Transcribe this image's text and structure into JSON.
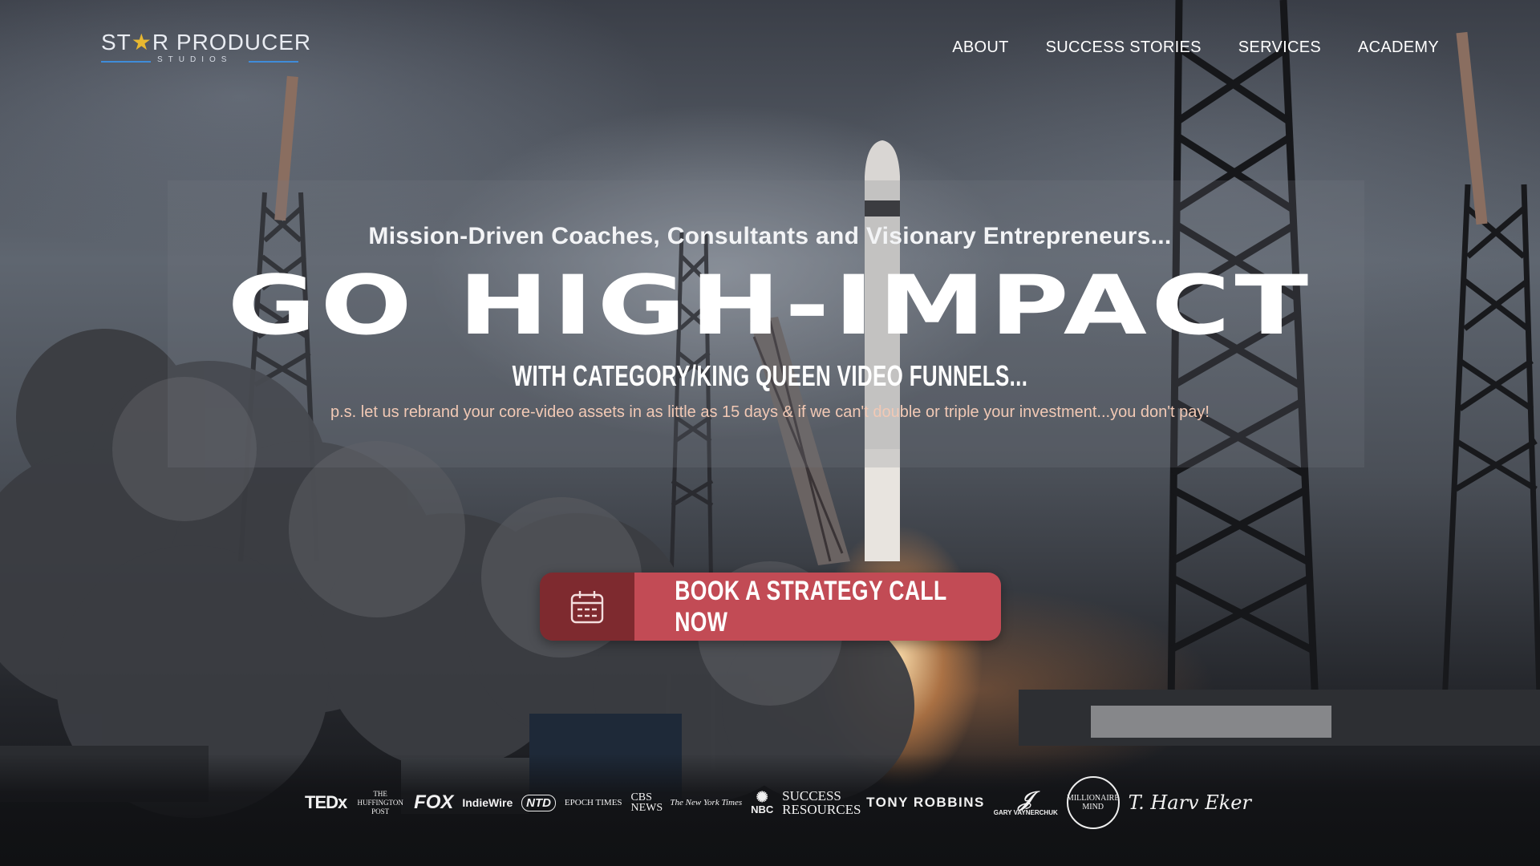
{
  "header": {
    "logo": {
      "text_before_star": "ST",
      "star_glyph": "★",
      "text_after_star": "R PRODUCER",
      "subtext": "STUDIOS"
    },
    "nav": [
      {
        "label": "ABOUT"
      },
      {
        "label": "SUCCESS STORIES"
      },
      {
        "label": "SERVICES"
      },
      {
        "label": "ACADEMY"
      }
    ]
  },
  "hero": {
    "eyebrow": "Mission-Driven Coaches, Consultants and Visionary Entrepreneurs...",
    "title": "GO HIGH-IMPACT",
    "subtitle": "WITH CATEGORY/KING QUEEN VIDEO FUNNELS...",
    "ps": "p.s. let us rebrand your core-video assets in as little as 15 days & if we can't double or triple your investment...you don't pay!",
    "cta": {
      "label": "BOOK A STRATEGY CALL NOW",
      "icon": "calendar-icon"
    }
  },
  "press_logos": [
    {
      "text": "TEDx"
    },
    {
      "text": "THE HUFFINGTON POST"
    },
    {
      "text": "FOX"
    },
    {
      "text": "IndieWire"
    },
    {
      "text": "NTD"
    },
    {
      "text": "EPOCH TIMES"
    },
    {
      "text": "CBS NEWS"
    },
    {
      "text": "The New York Times"
    },
    {
      "text": "NBC"
    },
    {
      "text": "SUCCESS RESOURCES"
    },
    {
      "text": "TONY ROBBINS"
    },
    {
      "text": "GARY VAYNERCHUK"
    },
    {
      "text": "MILLIONAIRE MIND"
    },
    {
      "text": "T. Harv Eker"
    }
  ],
  "colors": {
    "cta_primary": "#c24b55",
    "cta_dark": "#7e2a2f",
    "ps_text": "#f2c9b5",
    "logo_accent": "#3f8cd9",
    "logo_star": "#e8b830"
  }
}
